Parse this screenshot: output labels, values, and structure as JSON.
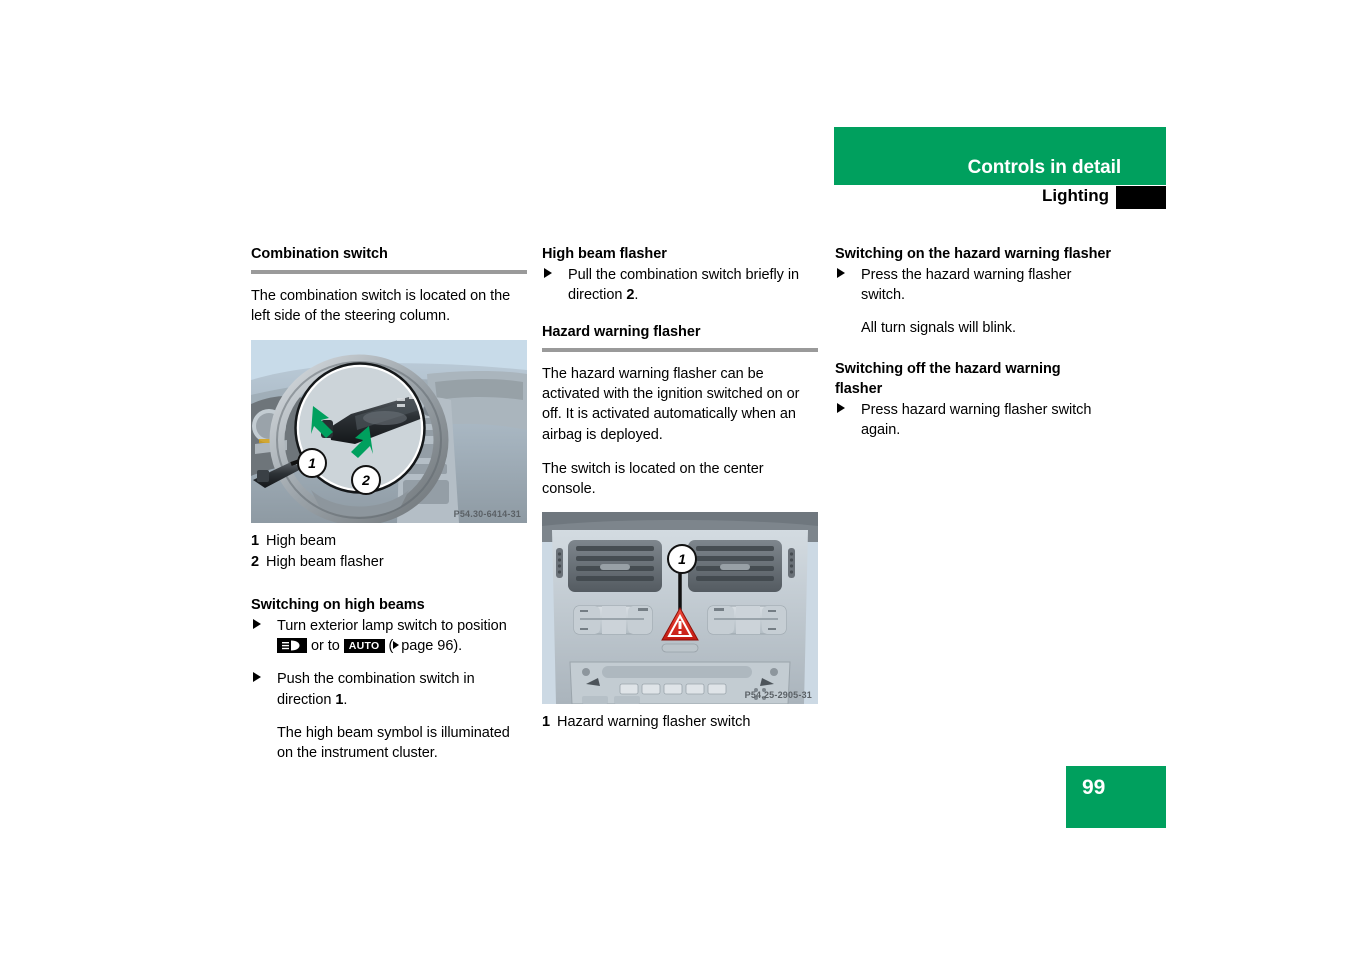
{
  "header": {
    "title": "Controls in detail",
    "section": "Lighting"
  },
  "footer": {
    "page_number": "99"
  },
  "colors": {
    "brand_green": "#00a05e",
    "rule_gray": "#9a9a9a",
    "tab_black": "#000000",
    "hazard_red": "#e2231a",
    "arrow_green": "#00a05e"
  },
  "columns": {
    "left": {
      "heading": "Combination switch",
      "intro": "The combination switch is located on the left side of the steering column.",
      "figure": {
        "code": "P54.30-6414-31",
        "alt": "Steering column with combination switch, magnified detail circle",
        "callouts": [
          "1",
          "2"
        ]
      },
      "legend": [
        {
          "num": "1",
          "label": "High beam"
        },
        {
          "num": "2",
          "label": "High beam flasher"
        }
      ],
      "heading2": "Switching on high beams",
      "bullets": [
        {
          "text_before": "Turn exterior lamp switch to position",
          "badge_lamp": "headlight-icon",
          "text_middle": "or to",
          "badge_auto": "AUTO",
          "text_after": "page 96)."
        },
        {
          "text_before": "Push the combination switch in direction",
          "bold": "1",
          "text_after": "."
        }
      ],
      "note": "The high beam symbol is illuminated on the instrument cluster."
    },
    "middle": {
      "heading": "High beam flasher",
      "bullet": {
        "text_before": "Pull the combination switch briefly in direction",
        "bold": "2",
        "text_after": "."
      },
      "heading2": "Hazard warning flasher",
      "para1": "The hazard warning flasher can be activated with the ignition switched on or off. It is activated automatically when an airbag is deployed.",
      "para2": "The switch is located on the center console.",
      "figure": {
        "code": "P54.25-2905-31",
        "alt": "Center console with hazard warning flasher switch",
        "callouts": [
          "1"
        ]
      },
      "legend": [
        {
          "num": "1",
          "label": "Hazard warning flasher switch"
        }
      ]
    },
    "right": {
      "heading": "Switching on the hazard warning flasher",
      "bullet": "Press the hazard warning flasher switch.",
      "note": "All turn signals will blink.",
      "heading2": "Switching off the hazard warning flasher",
      "bullet2": "Press hazard warning flasher switch again."
    }
  }
}
